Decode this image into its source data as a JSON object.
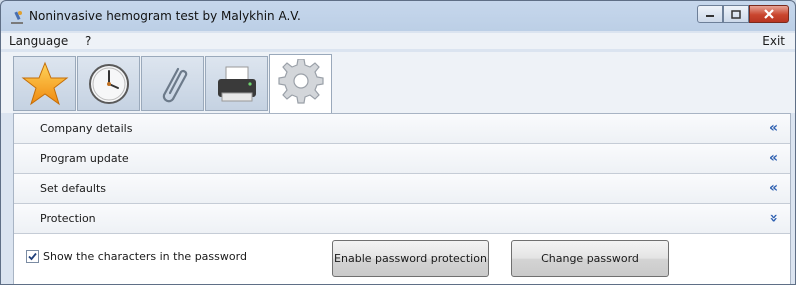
{
  "window": {
    "title": "Noninvasive hemogram test by Malykhin A.V."
  },
  "menu": {
    "language": "Language",
    "help": "?",
    "exit": "Exit"
  },
  "toolbar": {
    "tools": [
      {
        "name": "favorites",
        "icon": "star-icon"
      },
      {
        "name": "history",
        "icon": "clock-icon"
      },
      {
        "name": "attachments",
        "icon": "paperclip-icon"
      },
      {
        "name": "print",
        "icon": "printer-icon"
      },
      {
        "name": "settings",
        "icon": "gear-icon",
        "active": true
      }
    ]
  },
  "sections": [
    {
      "label": "Company details",
      "arrow": "«"
    },
    {
      "label": "Program update",
      "arrow": "«"
    },
    {
      "label": "Set defaults",
      "arrow": "«"
    },
    {
      "label": "Protection",
      "arrow": "»"
    }
  ],
  "protection": {
    "show_chars_label": "Show the characters in the password",
    "show_chars_checked": true,
    "enable_button": "Enable password protection",
    "change_button": "Change password"
  },
  "colors": {
    "accent_arrow": "#2d5fb0",
    "close_button": "#c9462e"
  }
}
